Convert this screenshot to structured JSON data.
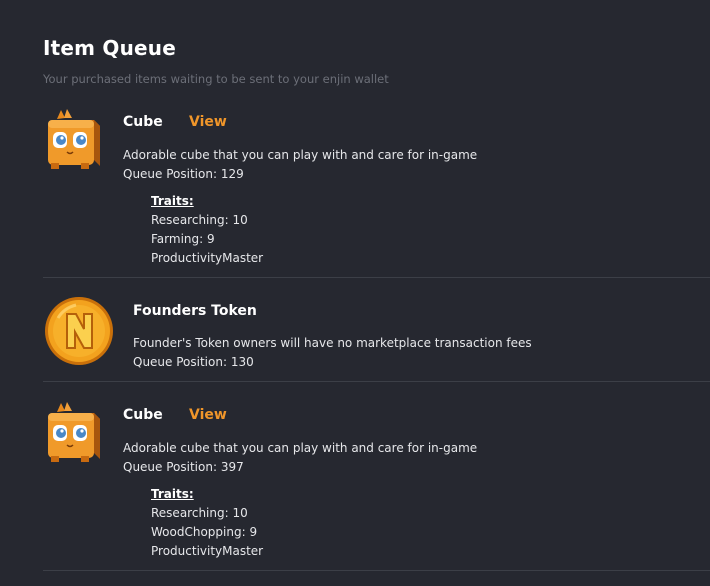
{
  "header": {
    "title": "Item Queue",
    "subtitle": "Your purchased items waiting to be sent to your enjin wallet"
  },
  "items": [
    {
      "name": "Cube",
      "view_label": "View",
      "description": "Adorable cube that you can play with and care for in-game",
      "queue": "Queue Position: 129",
      "traits_label": "Traits:",
      "traits": [
        "Researching: 10",
        "Farming: 9",
        "ProductivityMaster"
      ],
      "icon": "cube-pet-icon"
    },
    {
      "name": "Founders Token",
      "description": "Founder's Token owners will have no marketplace transaction fees",
      "queue": "Queue Position: 130",
      "icon": "founders-token-coin-icon"
    },
    {
      "name": "Cube",
      "view_label": "View",
      "description": "Adorable cube that you can play with and care for in-game",
      "queue": "Queue Position: 397",
      "traits_label": "Traits:",
      "traits": [
        "Researching: 10",
        "WoodChopping: 9",
        "ProductivityMaster"
      ],
      "icon": "cube-pet-icon"
    }
  ],
  "colors": {
    "background": "#262830",
    "accent": "#f0962a",
    "divider": "#3c3f47",
    "muted": "#6c6f78"
  }
}
